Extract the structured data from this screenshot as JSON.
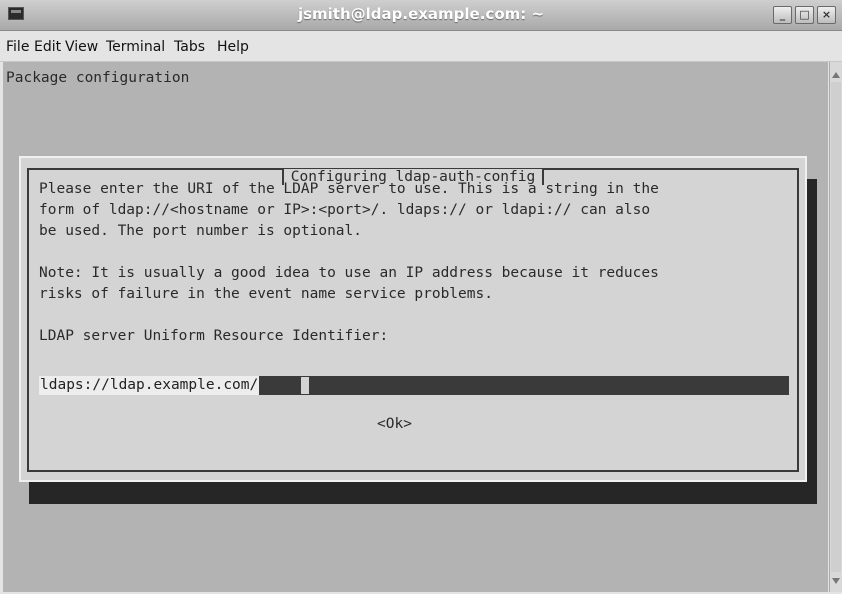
{
  "window": {
    "title": "jsmith@ldap.example.com: ~"
  },
  "menu": [
    "File",
    "Edit",
    "View",
    "Terminal",
    "Tabs",
    "Help"
  ],
  "terminal": {
    "heading": "Package configuration"
  },
  "dialog": {
    "title": "Configuring ldap-auth-config",
    "para1": "Please enter the URI of the LDAP server to use. This is a string in the\nform of ldap://<hostname or IP>:<port>/. ldaps:// or ldapi:// can also\nbe used. The port number is optional.",
    "para2": "Note: It is usually a good idea to use an IP address because it reduces\nrisks of failure in the event name service problems.",
    "prompt": "LDAP server Uniform Resource Identifier:",
    "input_value": "ldaps://ldap.example.com/",
    "ok_label": "<Ok>"
  },
  "colors": {
    "terminal_bg": "#b3b3b3",
    "dialog_bg": "#d4d4d4",
    "input_bg": "#3a3a3a"
  }
}
